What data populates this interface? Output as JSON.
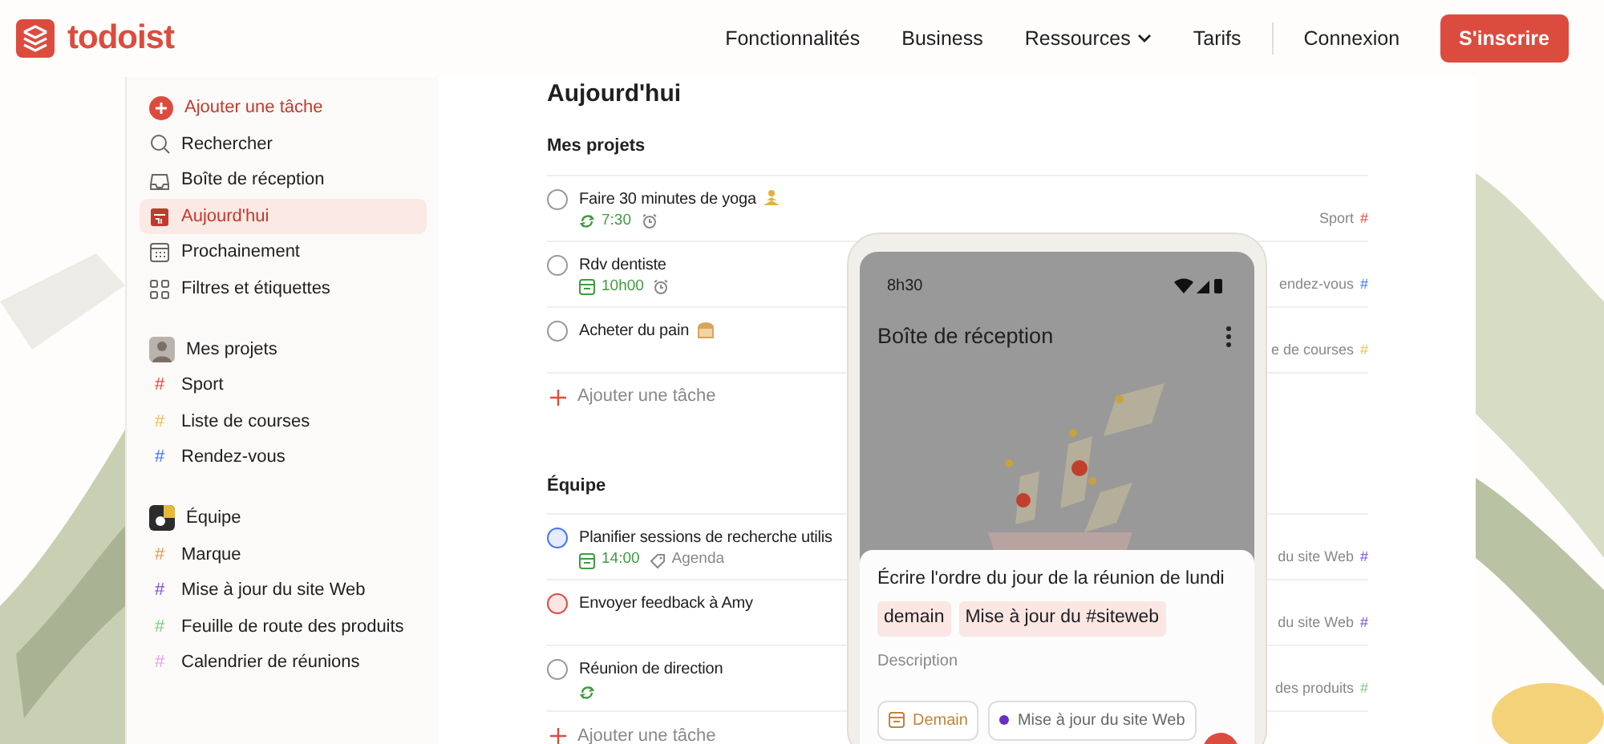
{
  "nav": {
    "logo": "todoist",
    "links": [
      {
        "label": "Fonctionnalités",
        "dropdown": false
      },
      {
        "label": "Business",
        "dropdown": false
      },
      {
        "label": "Ressources",
        "dropdown": true
      },
      {
        "label": "Tarifs",
        "dropdown": false
      }
    ],
    "login": "Connexion",
    "signup": "S'inscrire"
  },
  "sidebar": {
    "add_task": "Ajouter une tâche",
    "items": [
      {
        "kind": "search",
        "label": "Rechercher",
        "selected": false
      },
      {
        "kind": "inbox",
        "label": "Boîte de réception",
        "selected": false
      },
      {
        "kind": "today",
        "label": "Aujourd'hui",
        "selected": true
      },
      {
        "kind": "upcoming",
        "label": "Prochainement",
        "selected": false
      },
      {
        "kind": "filters",
        "label": "Filtres et étiquettes",
        "selected": false
      }
    ],
    "groups": [
      {
        "title": "Mes projets",
        "projects": [
          {
            "mark": "#",
            "label": "Sport",
            "color": "#dc4c3e"
          },
          {
            "mark": "#",
            "label": "Liste de courses",
            "color": "#f0c24a"
          },
          {
            "mark": "#",
            "label": "Rendez-vous",
            "color": "#4073ff"
          }
        ]
      },
      {
        "title": "Équipe",
        "projects": [
          {
            "mark": "#",
            "label": "Marque",
            "color": "#eb9a4a"
          },
          {
            "mark": "#",
            "label": "Mise à jour du site Web",
            "color": "#7a4ad8"
          },
          {
            "mark": "#",
            "label": "Feuille de route des produits",
            "color": "#7ecc80"
          },
          {
            "mark": "#",
            "label": "Calendrier de réunions",
            "color": "#e9a0e8"
          }
        ]
      }
    ]
  },
  "main": {
    "title": "Aujourd'hui",
    "sections": [
      {
        "title": "Mes projets",
        "add": "Ajouter une tâche",
        "tasks": [
          {
            "title": "Faire 30 minutes de yoga",
            "color": "#999999",
            "meta": [
              {
                "kind": "recurring",
                "text": "7:30"
              },
              {
                "kind": "alarm"
              }
            ],
            "project": {
              "name": "Sport",
              "mark": "#",
              "color": "#dc4c3e"
            }
          },
          {
            "title": "Rdv dentiste",
            "color": "#999999",
            "meta": [
              {
                "kind": "date",
                "text": "10h00"
              },
              {
                "kind": "alarm"
              }
            ],
            "project": {
              "name": "endez-vous",
              "mark": "#",
              "color": "#4073ff"
            }
          },
          {
            "title": "Acheter du pain",
            "color": "#999999",
            "project": {
              "name": "e de courses",
              "mark": "#",
              "color": "#f0c24a"
            }
          }
        ]
      },
      {
        "title": "Équipe",
        "add": "Ajouter une tâche",
        "tasks": [
          {
            "title": "Planifier sessions de recherche utilis",
            "color": "#4073ff",
            "meta": [
              {
                "kind": "date",
                "text": "14:00"
              },
              {
                "kind": "label",
                "text": "Agenda"
              }
            ],
            "project": {
              "name": "du site Web",
              "mark": "#",
              "color": "#7a4ad8"
            }
          },
          {
            "title": "Envoyer feedback à Amy",
            "color": "#dc4c3e",
            "project": {
              "name": "du site Web",
              "mark": "#",
              "color": "#7a4ad8"
            }
          },
          {
            "title": "Réunion de direction",
            "color": "#999999",
            "meta": [
              {
                "kind": "recurring"
              }
            ],
            "project": {
              "name": "des produits",
              "mark": "#",
              "color": "#7ecc80"
            }
          }
        ]
      }
    ]
  },
  "phone": {
    "time": "8h30",
    "title": "Boîte de réception",
    "sheet": {
      "task": "Écrire l'ordre du jour de la réunion de lundi",
      "chips": [
        "demain",
        "Mise à jour du #siteweb"
      ],
      "placeholder": "Description",
      "buttons": [
        {
          "kind": "date",
          "label": "Demain"
        },
        {
          "kind": "project",
          "label": "Mise à jour du site Web",
          "color": "#692ec2"
        }
      ]
    }
  }
}
